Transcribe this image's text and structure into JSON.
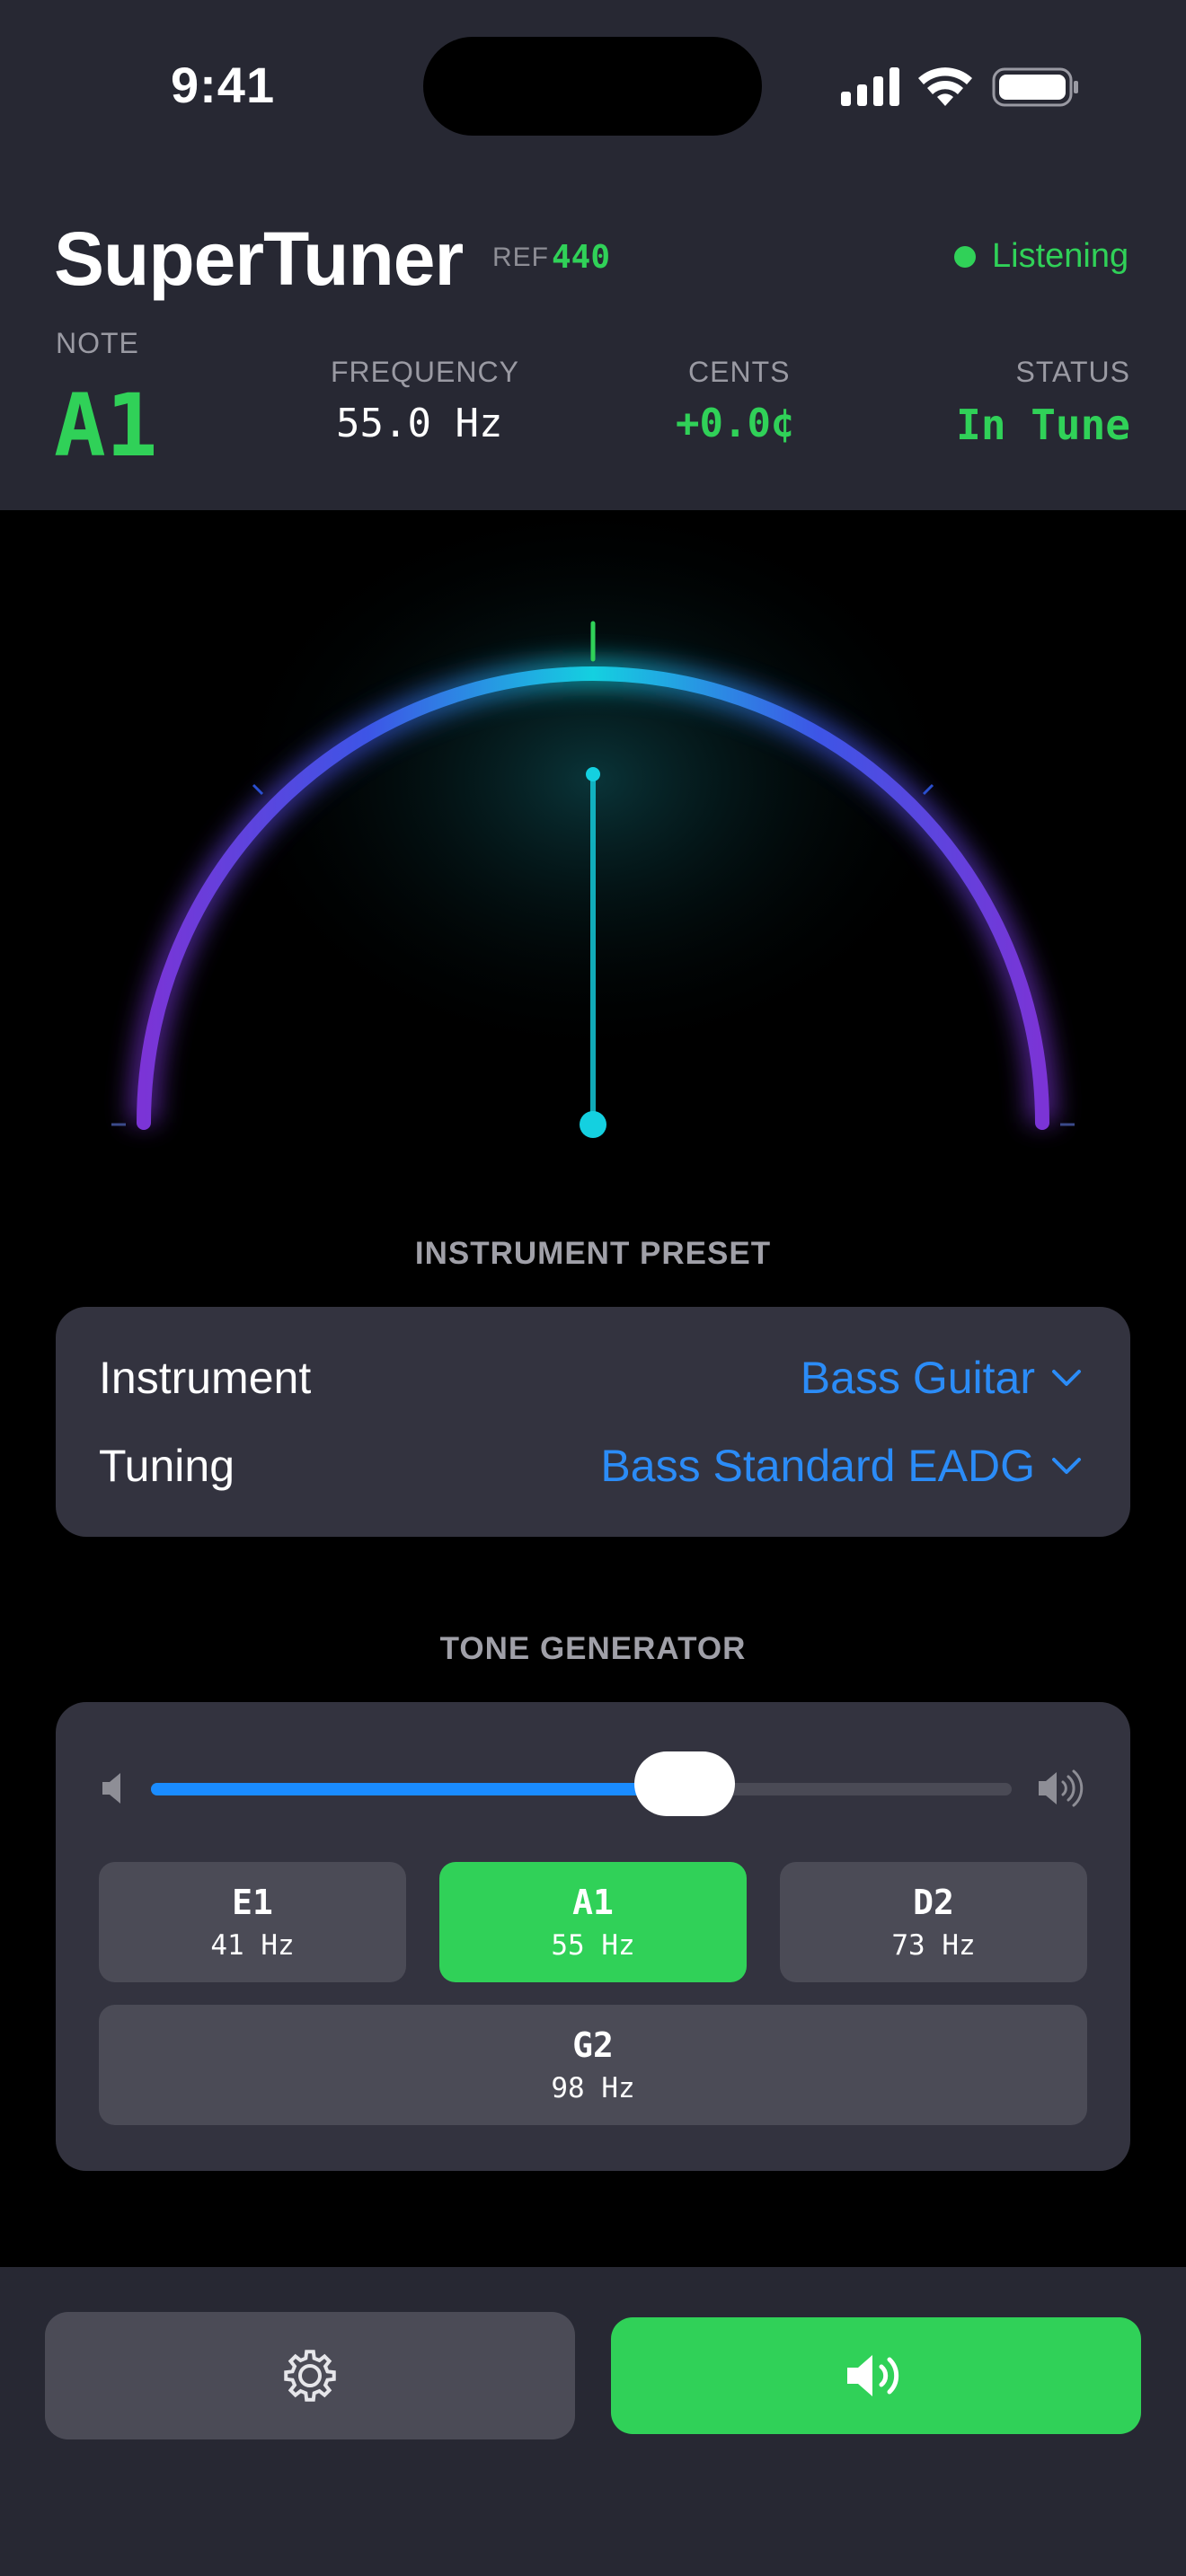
{
  "status_bar": {
    "time": "9:41"
  },
  "header": {
    "app_title": "SuperTuner",
    "ref_label": "REF",
    "ref_value": "440",
    "listening_label": "Listening",
    "note_label": "NOTE",
    "note_value": "A1",
    "frequency_label": "FREQUENCY",
    "frequency_value": "55.0 Hz",
    "cents_label": "CENTS",
    "cents_value": "+0.0¢",
    "status_label": "STATUS",
    "status_value": "In Tune"
  },
  "gauge": {
    "cents_deviation": 0
  },
  "preset": {
    "section_title": "INSTRUMENT PRESET",
    "instrument_label": "Instrument",
    "instrument_value": "Bass Guitar",
    "tuning_label": "Tuning",
    "tuning_value": "Bass Standard EADG"
  },
  "tone_generator": {
    "section_title": "TONE GENERATOR",
    "volume_fraction": 0.62,
    "notes": [
      {
        "name": "E1",
        "hz": "41 Hz",
        "active": false
      },
      {
        "name": "A1",
        "hz": "55 Hz",
        "active": true
      },
      {
        "name": "D2",
        "hz": "73 Hz",
        "active": false
      },
      {
        "name": "G2",
        "hz": "98 Hz",
        "active": false
      }
    ]
  },
  "bottom_bar": {
    "settings_icon": "gear-icon",
    "sound_icon": "speaker-icon"
  },
  "colors": {
    "accent_green": "#30d158",
    "accent_blue": "#1a8cff",
    "panel": "#272833",
    "card": "#33333f"
  }
}
